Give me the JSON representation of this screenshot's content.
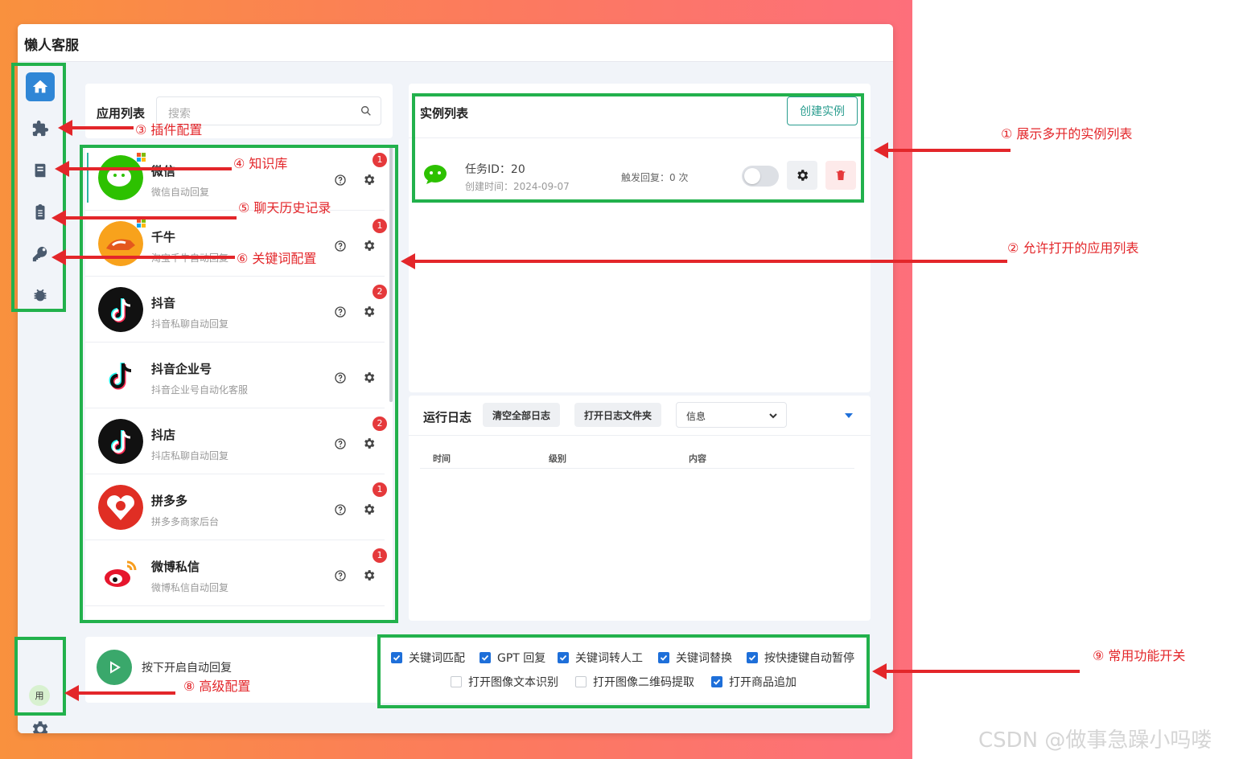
{
  "window": {
    "title": "懒人客服"
  },
  "sidebar": {
    "items": [
      "home-icon",
      "puzzle-icon",
      "book-icon",
      "clipboard-icon",
      "key-icon",
      "bug-icon"
    ],
    "user_badge": "用"
  },
  "app_list": {
    "label": "应用列表",
    "search_placeholder": "搜索",
    "apps": [
      {
        "name": "微信",
        "desc": "微信自动回复",
        "badge": "1"
      },
      {
        "name": "千牛",
        "desc": "淘宝千牛自动回复",
        "badge": "1"
      },
      {
        "name": "抖音",
        "desc": "抖音私聊自动回复",
        "badge": "2"
      },
      {
        "name": "抖音企业号",
        "desc": "抖音企业号自动化客服",
        "badge": ""
      },
      {
        "name": "抖店",
        "desc": "抖店私聊自动回复",
        "badge": "2"
      },
      {
        "name": "拼多多",
        "desc": "拼多多商家后台",
        "badge": "1"
      },
      {
        "name": "微博私信",
        "desc": "微博私信自动回复",
        "badge": "1"
      }
    ]
  },
  "instance_list": {
    "label": "实例列表",
    "create_button": "创建实例",
    "instances": [
      {
        "task_id": "任务ID：20",
        "created": "创建时间：2024-09-07",
        "trigger": "触发回复：0 次"
      }
    ]
  },
  "log": {
    "title": "运行日志",
    "clear_button": "清空全部日志",
    "open_button": "打开日志文件夹",
    "level_selected": "信息",
    "columns": [
      "时间",
      "级别",
      "内容"
    ]
  },
  "bottom": {
    "start_label": "按下开启自动回复",
    "checkboxes_row1": [
      {
        "label": "关键词匹配",
        "checked": true
      },
      {
        "label": "GPT 回复",
        "checked": true
      },
      {
        "label": "关键词转人工",
        "checked": true
      },
      {
        "label": "关键词替换",
        "checked": true
      },
      {
        "label": "按快捷键自动暂停",
        "checked": true
      }
    ],
    "checkboxes_row2": [
      {
        "label": "打开图像文本识别",
        "checked": false
      },
      {
        "label": "打开图像二维码提取",
        "checked": false
      },
      {
        "label": "打开商品追加",
        "checked": true
      }
    ]
  },
  "annotations": {
    "a1": "① 展示多开的实例列表",
    "a2": "② 允许打开的应用列表",
    "a3": "③ 插件配置",
    "a4": "④ 知识库",
    "a5": "⑤ 聊天历史记录",
    "a6": "⑥ 关键词配置",
    "a8": "⑧ 高级配置",
    "a9": "⑨ 常用功能开关"
  },
  "colors": {
    "accent_blue": "#2f86d6",
    "annotation_red": "#e3262a",
    "highlight_green": "#22b14c",
    "teal": "#2a9d8f"
  },
  "watermark": "CSDN @做事急躁小吗喽"
}
